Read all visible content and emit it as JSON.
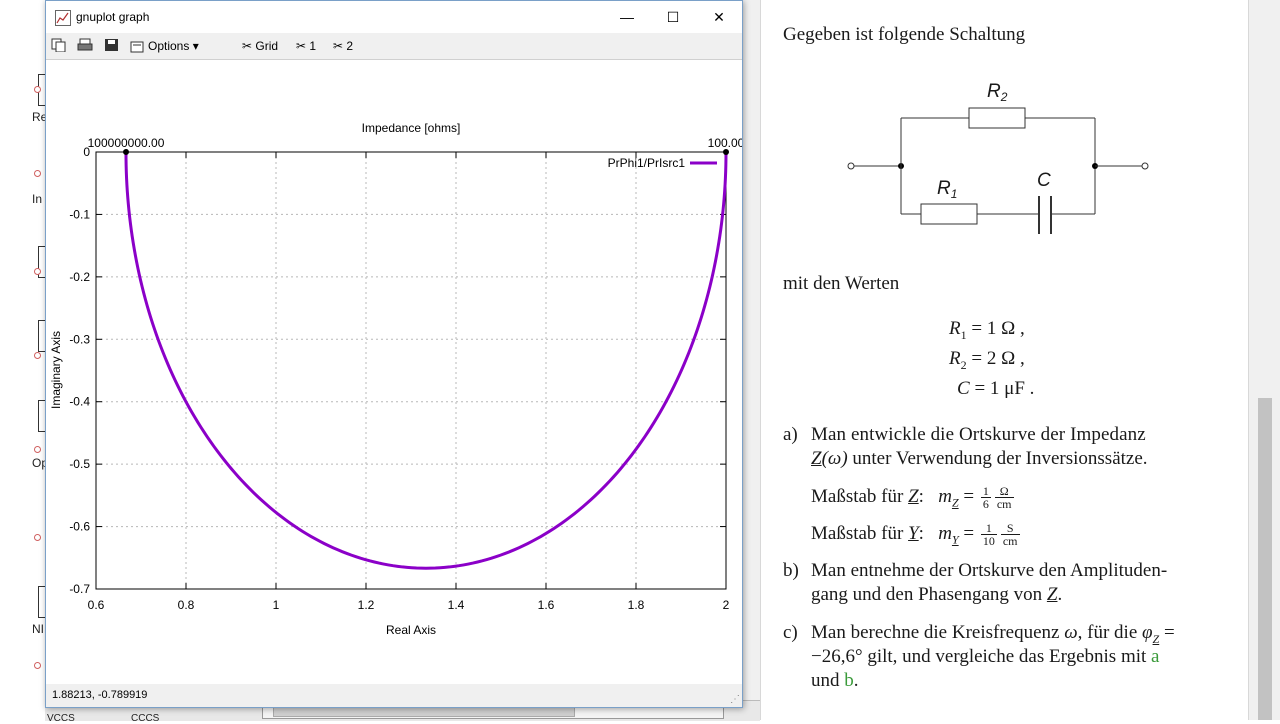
{
  "gnuplot_window": {
    "title": "gnuplot graph",
    "controls": {
      "minimize": "—",
      "maximize": "☐",
      "close": "✕"
    },
    "toolbar": {
      "options_label": "Options",
      "grid_label": "Grid",
      "item1_label": "1",
      "item2_label": "2"
    },
    "status_text": "1.88213, -0.789919"
  },
  "chart_data": {
    "type": "line",
    "title": "Impedance [ohms]",
    "xlabel": "Real Axis",
    "ylabel": "Imaginary Axis",
    "xlim": [
      0.6,
      2
    ],
    "ylim": [
      -0.7,
      0
    ],
    "x_ticks": [
      "0.6",
      "0.8",
      "1",
      "1.2",
      "1.4",
      "1.6",
      "1.8",
      "2"
    ],
    "y_ticks": [
      "0",
      "-0.1",
      "-0.2",
      "-0.3",
      "-0.4",
      "-0.5",
      "-0.6",
      "-0.7"
    ],
    "grid": true,
    "legend_position": "top-right",
    "point_labels": [
      {
        "text": "100000000.00",
        "x": 0.6667,
        "y": 0.0
      },
      {
        "text": "100.00",
        "x": 2.0,
        "y": 0.0
      }
    ],
    "series": [
      {
        "name": "PrPhi1/PrIsrc1",
        "color": "#8b00c8",
        "shape": "semicircle",
        "center": [
          1.3333,
          0
        ],
        "radius": 0.6667,
        "x_start": 0.6667,
        "x_end": 2.0,
        "y_min": -0.6667
      }
    ]
  },
  "document": {
    "intro": "Gegeben ist folgende Schaltung",
    "circuit": {
      "r2": "R",
      "r2_sub": "2",
      "r1": "R",
      "r1_sub": "1",
      "c": "C"
    },
    "values_intro": "mit den Werten",
    "values": [
      {
        "sym": "R",
        "sub": "1",
        "val": "= 1 Ω ,"
      },
      {
        "sym": "R",
        "sub": "2",
        "val": "= 2 Ω ,"
      },
      {
        "sym": "C",
        "sub": "",
        "val": "= 1 μF ."
      }
    ],
    "task_a_label": "a)",
    "task_a_line1": "Man entwickle die Ortskurve der Impedanz",
    "task_a_line2_sym": "Z",
    "task_a_line2_arg": "(ω)",
    "task_a_line2_rest": "unter Verwendung der Inversionssätze.",
    "scale_z_label": "Maßstab für",
    "scale_z_sym": "Z",
    "scale_z_m": "m",
    "scale_z_frac_num": "1",
    "scale_z_frac_den": "6",
    "scale_z_unit_num": "Ω",
    "scale_z_unit_den": "cm",
    "scale_y_label": "Maßstab für",
    "scale_y_sym": "Y",
    "scale_y_m": "m",
    "scale_y_frac_num": "1",
    "scale_y_frac_den": "10",
    "scale_y_unit_num": "S",
    "scale_y_unit_den": "cm",
    "task_b_label": "b)",
    "task_b_line1": "Man entnehme der Ortskurve den Amplituden-",
    "task_b_line2_pre": "gang und den Phasengang von",
    "task_b_line2_sym": "Z",
    "task_b_line2_post": ".",
    "task_c_label": "c)",
    "task_c_line1_pre": "Man berechne die Kreisfrequenz",
    "task_c_line1_omega": "ω",
    "task_c_line1_mid": ", für die",
    "task_c_line1_phi": "φ",
    "task_c_line1_sub": "Z",
    "task_c_line1_eq": "=",
    "task_c_line2_pre": "−26,6° gilt, und vergleiche das Ergebnis mit",
    "task_c_line2_a": "a",
    "task_c_line3_pre": "und",
    "task_c_line3_b": "b",
    "task_c_line3_post": "."
  },
  "background_app": {
    "labels": [
      "Re",
      "In",
      "Op",
      "NI"
    ],
    "bottom_labels": [
      "VCCS",
      "CCCS"
    ]
  }
}
